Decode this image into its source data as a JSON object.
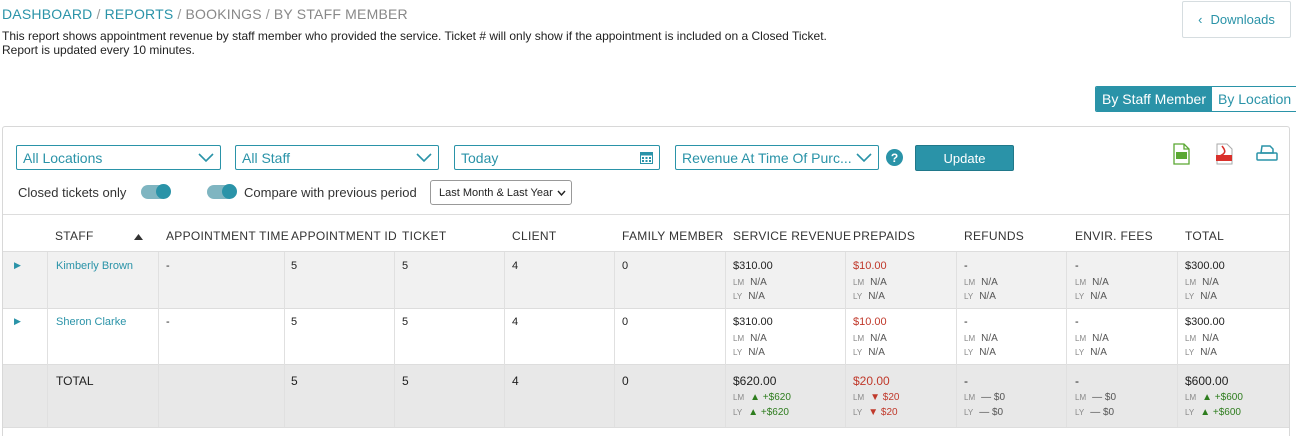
{
  "breadcrumb": {
    "items": [
      "DASHBOARD",
      "REPORTS",
      "BOOKINGS",
      "BY STAFF MEMBER"
    ],
    "sep": "/"
  },
  "description": {
    "line1": "This report shows appointment revenue by staff member who provided the service. Ticket # will only show if the appointment is included on a Closed Ticket.",
    "line2": "Report is updated every 10 minutes."
  },
  "downloads": {
    "label": "Downloads",
    "icon": "chevron-left-icon"
  },
  "view_toggle": {
    "by_staff": "By Staff Member",
    "by_location": "By Location",
    "active": "by_staff"
  },
  "filters": {
    "location": "All Locations",
    "staff": "All Staff",
    "date": "Today",
    "revenue_mode": "Revenue At Time Of Purc...",
    "help": "?",
    "update": "Update",
    "closed_tickets_label": "Closed tickets only",
    "compare_label": "Compare with previous period",
    "compare_period": "Last Month & Last Year"
  },
  "export_icons": {
    "csv": "csv-file-icon",
    "pdf": "pdf-file-icon",
    "print": "print-icon"
  },
  "accent": "#2a93a8",
  "table": {
    "columns": [
      "STAFF",
      "APPOINTMENT TIME",
      "APPOINTMENT ID",
      "TICKET",
      "CLIENT",
      "FAMILY MEMBER",
      "SERVICE REVENUE",
      "PREPAIDS",
      "REFUNDS",
      "ENVIR. FEES",
      "TOTAL"
    ],
    "sub_keys": {
      "lm": "LM",
      "ly": "LY"
    },
    "rows": [
      {
        "staff": "Kimberly Brown",
        "time": "-",
        "appt_id": "5",
        "ticket": "5",
        "client": "4",
        "family": "0",
        "service": "$310.00",
        "service_lm": "N/A",
        "service_ly": "N/A",
        "prepaids": "$10.00",
        "prepaids_lm": "N/A",
        "prepaids_ly": "N/A",
        "refunds": "-",
        "refunds_lm": "N/A",
        "refunds_ly": "N/A",
        "envir": "-",
        "envir_lm": "N/A",
        "envir_ly": "N/A",
        "total": "$300.00",
        "total_lm": "N/A",
        "total_ly": "N/A"
      },
      {
        "staff": "Sheron Clarke",
        "time": "-",
        "appt_id": "5",
        "ticket": "5",
        "client": "4",
        "family": "0",
        "service": "$310.00",
        "service_lm": "N/A",
        "service_ly": "N/A",
        "prepaids": "$10.00",
        "prepaids_lm": "N/A",
        "prepaids_ly": "N/A",
        "refunds": "-",
        "refunds_lm": "N/A",
        "refunds_ly": "N/A",
        "envir": "-",
        "envir_lm": "N/A",
        "envir_ly": "N/A",
        "total": "$300.00",
        "total_lm": "N/A",
        "total_ly": "N/A"
      }
    ],
    "totals": {
      "label": "TOTAL",
      "time": "",
      "appt_id": "5",
      "ticket": "5",
      "client": "4",
      "family": "0",
      "service": "$620.00",
      "service_lm": "▲ +$620",
      "service_ly": "▲ +$620",
      "prepaids": "$20.00",
      "prepaids_lm": "▼ $20",
      "prepaids_ly": "▼ $20",
      "refunds": "-",
      "refunds_lm": "— $0",
      "refunds_ly": "— $0",
      "envir": "-",
      "envir_lm": "— $0",
      "envir_ly": "— $0",
      "total": "$600.00",
      "total_lm": "▲ +$600",
      "total_ly": "▲ +$600"
    }
  }
}
